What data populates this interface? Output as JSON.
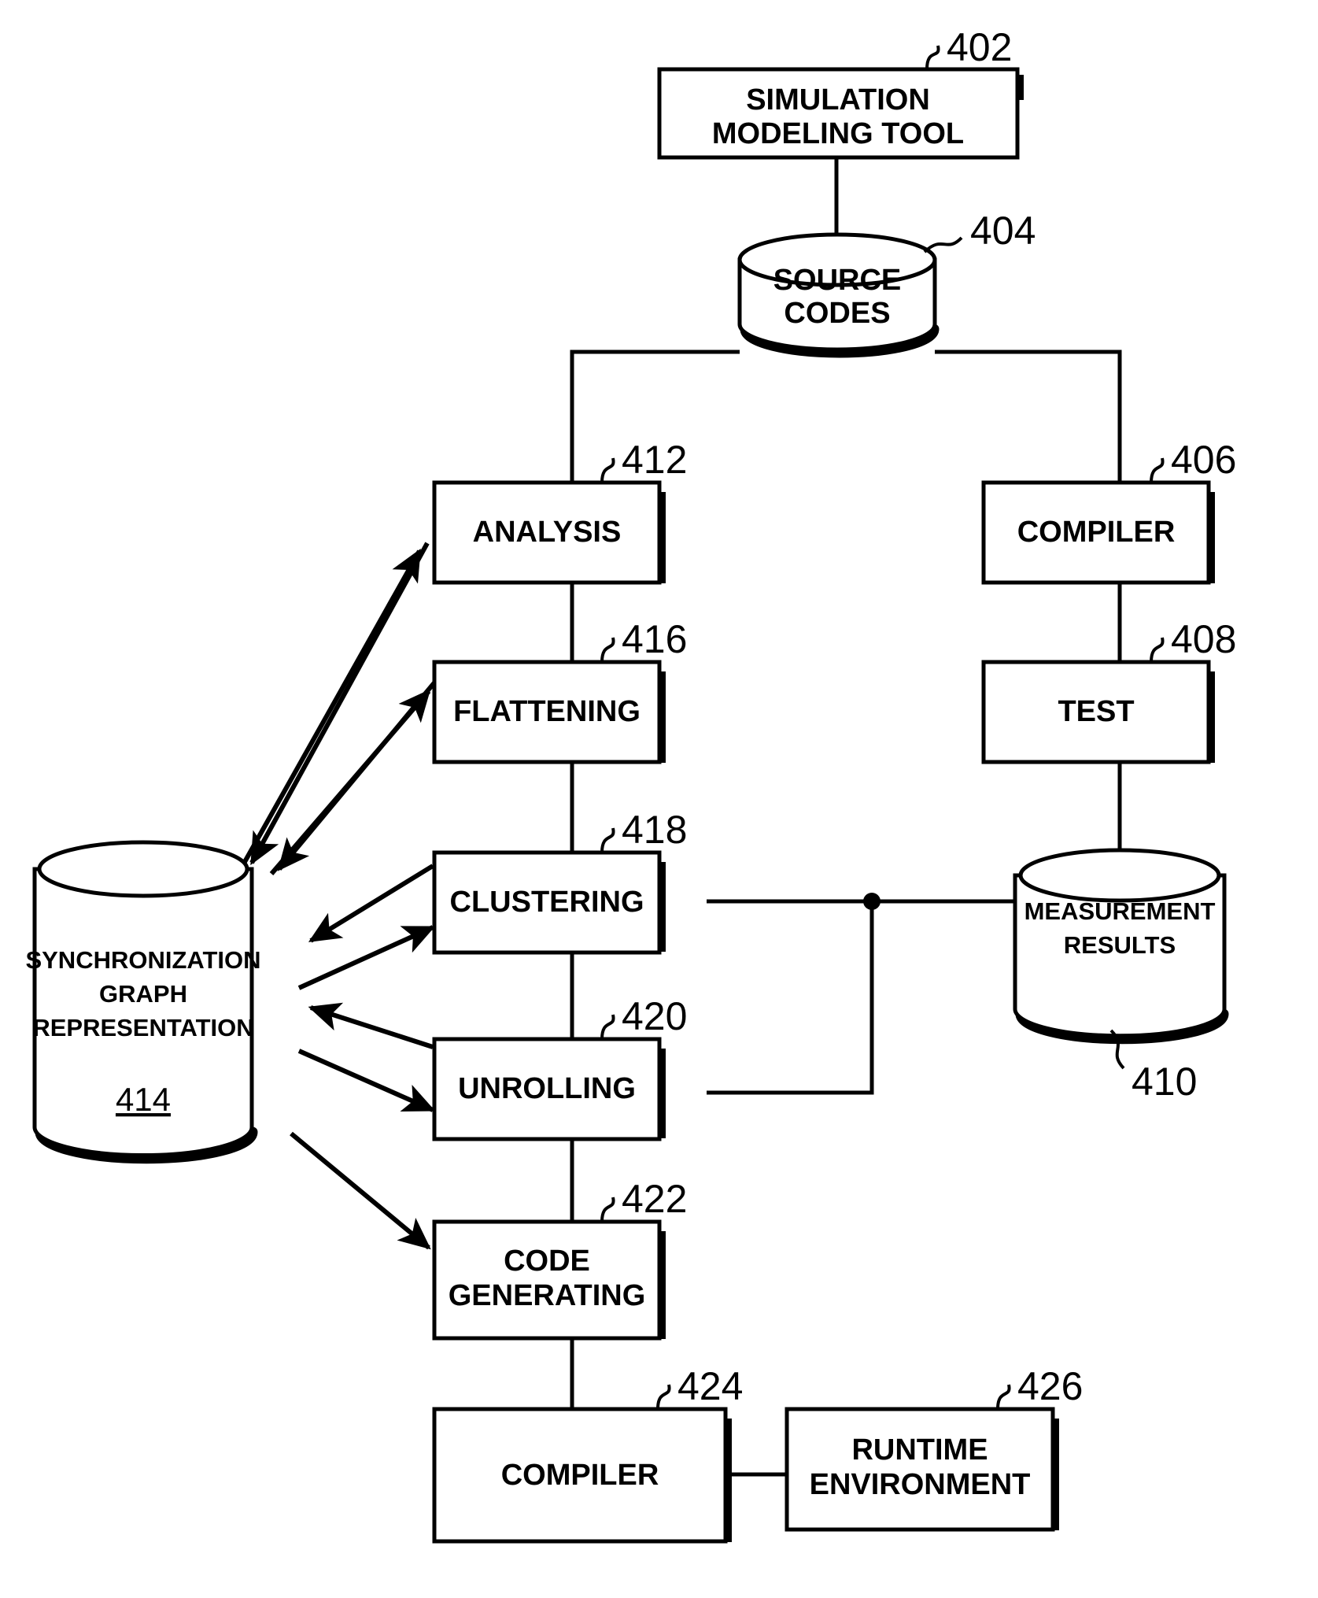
{
  "figure": {
    "title": "Simulation modeling tool compilation flow diagram",
    "background_color": "#ffffff",
    "line_color": "#000000"
  },
  "nodes": {
    "simulation_modeling_tool": {
      "label_line1": "SIMULATION",
      "label_line2": "MODELING TOOL",
      "ref": "402",
      "shape": "box"
    },
    "source_codes": {
      "label_line1": "SOURCE",
      "label_line2": "CODES",
      "ref": "404",
      "shape": "cylinder"
    },
    "compiler_right": {
      "label_line1": "COMPILER",
      "ref": "406",
      "shape": "box"
    },
    "test": {
      "label_line1": "TEST",
      "ref": "408",
      "shape": "box"
    },
    "measurement_results": {
      "label_line1": "MEASUREMENT",
      "label_line2": "RESULTS",
      "ref": "410",
      "shape": "cylinder"
    },
    "analysis": {
      "label_line1": "ANALYSIS",
      "ref": "412",
      "shape": "box"
    },
    "sync_graph_representation": {
      "label_line1": "SYNCHRONIZATION",
      "label_line2": "GRAPH",
      "label_line3": "REPRESENTATION",
      "ref": "414",
      "ref_underlined": true,
      "shape": "cylinder"
    },
    "flattening": {
      "label_line1": "FLATTENING",
      "ref": "416",
      "shape": "box"
    },
    "clustering": {
      "label_line1": "CLUSTERING",
      "ref": "418",
      "shape": "box"
    },
    "unrolling": {
      "label_line1": "UNROLLING",
      "ref": "420",
      "shape": "box"
    },
    "code_generating": {
      "label_line1": "CODE",
      "label_line2": "GENERATING",
      "ref": "422",
      "shape": "box"
    },
    "compiler_bottom": {
      "label_line1": "COMPILER",
      "ref": "424",
      "shape": "box"
    },
    "runtime_environment": {
      "label_line1": "RUNTIME",
      "label_line2": "ENVIRONMENT",
      "ref": "426",
      "shape": "box"
    }
  }
}
